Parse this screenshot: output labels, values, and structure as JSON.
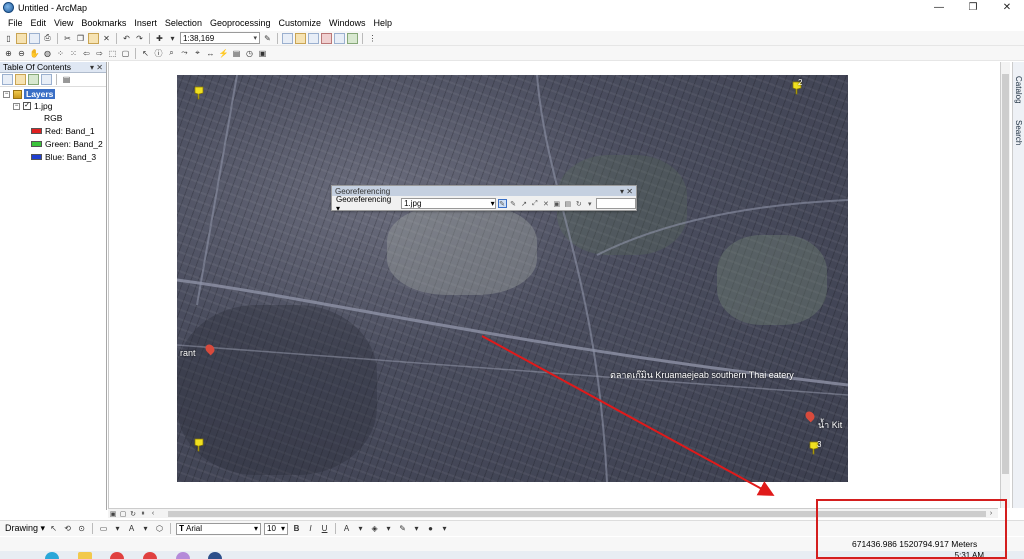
{
  "window": {
    "title": "Untitled - ArcMap",
    "minimize": "—",
    "maximize": "❐",
    "close": "✕"
  },
  "menu": [
    "File",
    "Edit",
    "View",
    "Bookmarks",
    "Insert",
    "Selection",
    "Geoprocessing",
    "Customize",
    "Windows",
    "Help"
  ],
  "toolbar": {
    "scale": "1:38,169"
  },
  "toc": {
    "title": "Table Of Contents",
    "pin_glyphs": "▾ ✕",
    "data_frame": "Layers",
    "layer": "1.jpg",
    "render_type": "RGB",
    "bands": [
      {
        "label": "Red:",
        "band": "Band_1",
        "color": "#e02020"
      },
      {
        "label": "Green:",
        "band": "Band_2",
        "color": "#3bc43b"
      },
      {
        "label": "Blue:",
        "band": "Band_3",
        "color": "#2040d0"
      }
    ]
  },
  "georeferencing": {
    "title": "Georeferencing",
    "menu_label": "Georeferencing",
    "layer_value": "1.jpg"
  },
  "map": {
    "labels": {
      "left": "rant",
      "center": "ตลาดเก๊มิน Kruamaejeab southern Thai eatery",
      "right": "น้ำ Kit"
    },
    "control_points": [
      "",
      "2",
      "",
      "3"
    ]
  },
  "side_tabs": [
    "Catalog",
    "Search"
  ],
  "drawing": {
    "menu_label": "Drawing",
    "font": "Arial",
    "font_size": "10",
    "bold": "B",
    "italic": "I",
    "underline": "U"
  },
  "status": {
    "coords": "671436.986  1520794.917 Meters"
  },
  "taskbar": {
    "time": "5:31 AM"
  },
  "annotation_colors": {
    "highlight": "#d41e1e",
    "arrow": "#e01a1a"
  }
}
